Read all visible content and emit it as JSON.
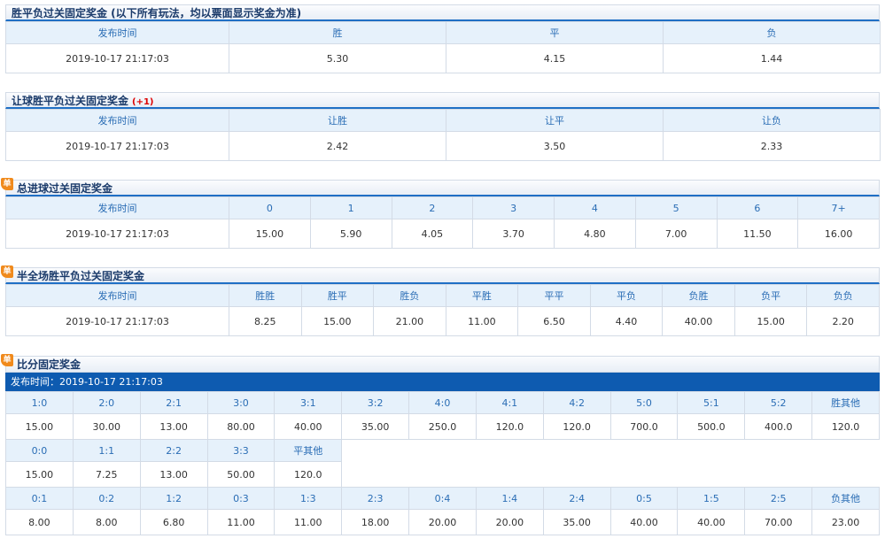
{
  "colors": {
    "accent": "#1f6fc5",
    "header_bg": "#e6f1fb",
    "header_text": "#2a6db5",
    "score_bar": "#0e5bb0",
    "badge": "#f08a1c",
    "note_red": "#dd0000"
  },
  "badge_text": "单",
  "wdl": {
    "title": "胜平负过关固定奖金 (以下所有玩法，均以票面显示奖金为准)",
    "headers": [
      "发布时间",
      "胜",
      "平",
      "负"
    ],
    "values": [
      "2019-10-17 21:17:03",
      "5.30",
      "4.15",
      "1.44"
    ]
  },
  "handicap": {
    "title": "让球胜平负过关固定奖金",
    "extra": "(+1)",
    "headers": [
      "发布时间",
      "让胜",
      "让平",
      "让负"
    ],
    "values": [
      "2019-10-17 21:17:03",
      "2.42",
      "3.50",
      "2.33"
    ]
  },
  "total_goals": {
    "title": "总进球过关固定奖金",
    "headers": [
      "发布时间",
      "0",
      "1",
      "2",
      "3",
      "4",
      "5",
      "6",
      "7+"
    ],
    "values": [
      "2019-10-17 21:17:03",
      "15.00",
      "5.90",
      "4.05",
      "3.70",
      "4.80",
      "7.00",
      "11.50",
      "16.00"
    ]
  },
  "half_full": {
    "title": "半全场胜平负过关固定奖金",
    "headers": [
      "发布时间",
      "胜胜",
      "胜平",
      "胜负",
      "平胜",
      "平平",
      "平负",
      "负胜",
      "负平",
      "负负"
    ],
    "values": [
      "2019-10-17 21:17:03",
      "8.25",
      "15.00",
      "21.00",
      "11.00",
      "6.50",
      "4.40",
      "40.00",
      "15.00",
      "2.20"
    ]
  },
  "score": {
    "title": "比分固定奖金",
    "publish_time": "发布时间：2019-10-17 21:17:03",
    "win_heads": [
      "1:0",
      "2:0",
      "2:1",
      "3:0",
      "3:1",
      "3:2",
      "4:0",
      "4:1",
      "4:2",
      "5:0",
      "5:1",
      "5:2",
      "胜其他"
    ],
    "win_vals": [
      "15.00",
      "30.00",
      "13.00",
      "80.00",
      "40.00",
      "35.00",
      "250.0",
      "120.0",
      "120.0",
      "700.0",
      "500.0",
      "400.0",
      "120.0"
    ],
    "draw_heads": [
      "0:0",
      "1:1",
      "2:2",
      "3:3",
      "平其他"
    ],
    "draw_vals": [
      "15.00",
      "7.25",
      "13.00",
      "50.00",
      "120.0"
    ],
    "loss_heads": [
      "0:1",
      "0:2",
      "1:2",
      "0:3",
      "1:3",
      "2:3",
      "0:4",
      "1:4",
      "2:4",
      "0:5",
      "1:5",
      "2:5",
      "负其他"
    ],
    "loss_vals": [
      "8.00",
      "8.00",
      "6.80",
      "11.00",
      "11.00",
      "18.00",
      "20.00",
      "20.00",
      "35.00",
      "40.00",
      "40.00",
      "70.00",
      "23.00"
    ]
  }
}
